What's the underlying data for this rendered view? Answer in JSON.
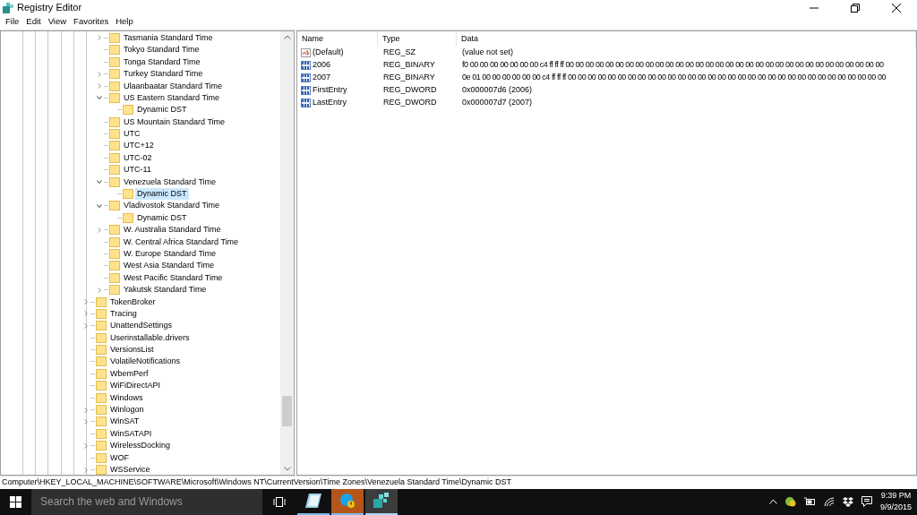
{
  "window": {
    "title": "Registry Editor"
  },
  "menu": [
    "File",
    "Edit",
    "View",
    "Favorites",
    "Help"
  ],
  "tree": [
    {
      "children": [
        {
          "label": "Tasmania Standard Time",
          "expanded": false,
          "selected": false
        },
        {
          "label": "Tokyo Standard Time",
          "selected": false
        },
        {
          "label": "Tonga Standard Time",
          "selected": false
        },
        {
          "label": "Turkey Standard Time",
          "expanded": false,
          "selected": false
        },
        {
          "label": "Ulaanbaatar Standard Time",
          "expanded": false,
          "selected": false
        },
        {
          "label": "US Eastern Standard Time",
          "expanded": true,
          "selected": false,
          "children": [
            {
              "label": "Dynamic DST",
              "selected": false
            }
          ]
        },
        {
          "label": "US Mountain Standard Time",
          "selected": false
        },
        {
          "label": "UTC",
          "selected": false
        },
        {
          "label": "UTC+12",
          "selected": false
        },
        {
          "label": "UTC-02",
          "selected": false
        },
        {
          "label": "UTC-11",
          "selected": false
        },
        {
          "label": "Venezuela Standard Time",
          "expanded": true,
          "selected": false,
          "children": [
            {
              "label": "Dynamic DST",
              "selected": true
            }
          ]
        },
        {
          "label": "Vladivostok Standard Time",
          "expanded": true,
          "selected": false,
          "children": [
            {
              "label": "Dynamic DST",
              "selected": false
            }
          ]
        },
        {
          "label": "W. Australia Standard Time",
          "expanded": false,
          "selected": false
        },
        {
          "label": "W. Central Africa Standard Time",
          "selected": false
        },
        {
          "label": "W. Europe Standard Time",
          "selected": false
        },
        {
          "label": "West Asia Standard Time",
          "selected": false
        },
        {
          "label": "West Pacific Standard Time",
          "selected": false
        },
        {
          "label": "Yakutsk Standard Time",
          "expanded": false,
          "selected": false
        }
      ]
    },
    {
      "label": "TokenBroker",
      "expanded": false,
      "selected": false
    },
    {
      "label": "Tracing",
      "expanded": false,
      "selected": false
    },
    {
      "label": "UnattendSettings",
      "expanded": false,
      "selected": false
    },
    {
      "label": "Userinstallable.drivers",
      "selected": false
    },
    {
      "label": "VersionsList",
      "selected": false
    },
    {
      "label": "VolatileNotifications",
      "selected": false
    },
    {
      "label": "WbemPerf",
      "selected": false
    },
    {
      "label": "WiFiDirectAPI",
      "selected": false
    },
    {
      "label": "Windows",
      "selected": false
    },
    {
      "label": "Winlogon",
      "expanded": false,
      "selected": false
    },
    {
      "label": "WinSAT",
      "expanded": false,
      "selected": false
    },
    {
      "label": "WinSATAPI",
      "selected": false
    },
    {
      "label": "WirelessDocking",
      "expanded": false,
      "selected": false
    },
    {
      "label": "WOF",
      "selected": false
    },
    {
      "label": "WSService",
      "expanded": false,
      "selected": false
    }
  ],
  "values": {
    "columns": [
      "Name",
      "Type",
      "Data"
    ],
    "rows": [
      {
        "kind": "string",
        "name": "(Default)",
        "type": "REG_SZ",
        "data": "(value not set)"
      },
      {
        "kind": "binary",
        "name": "2006",
        "type": "REG_BINARY",
        "data": "f0 00 00 00 00 00 00 00 c4 ff ff ff 00 00 00 00 00 00 00 00 00 00 00 00 00 00 00 00 00 00 00 00 00 00 00 00 00 00 00 00 00 00 00 00"
      },
      {
        "kind": "binary",
        "name": "2007",
        "type": "REG_BINARY",
        "data": "0e 01 00 00 00 00 00 00 c4 ff ff ff 00 00 00 00 00 00 00 00 00 00 00 00 00 00 00 00 00 00 00 00 00 00 00 00 00 00 00 00 00 00 00 00"
      },
      {
        "kind": "binary",
        "name": "FirstEntry",
        "type": "REG_DWORD",
        "data": "0x000007d6 (2006)"
      },
      {
        "kind": "binary",
        "name": "LastEntry",
        "type": "REG_DWORD",
        "data": "0x000007d7 (2007)"
      }
    ]
  },
  "status_bar": "Computer\\HKEY_LOCAL_MACHINE\\SOFTWARE\\Microsoft\\Windows NT\\CurrentVersion\\Time Zones\\Venezuela Standard Time\\Dynamic DST",
  "taskbar": {
    "search_placeholder": "Search the web and Windows",
    "apps": [
      {
        "kind": "notes",
        "attention": false,
        "active": false
      },
      {
        "kind": "chat",
        "attention": true,
        "active": false
      },
      {
        "kind": "registry",
        "attention": false,
        "active": true
      }
    ],
    "time": "9:39 PM",
    "date": "9/9/2015"
  }
}
